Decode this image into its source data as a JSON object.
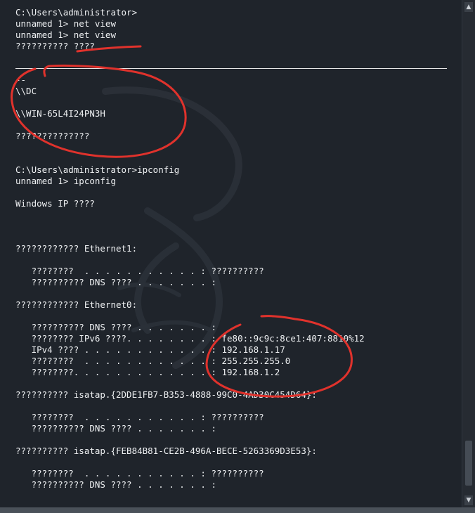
{
  "terminal": {
    "lines": [
      "C:\\Users\\administrator>",
      "unnamed 1> net view",
      "unnamed 1> net view",
      "?????????? ????",
      "",
      "",
      "--",
      "\\\\DC",
      "",
      "\\\\WIN-65L4I24PN3H",
      "",
      "??????????????",
      "",
      "",
      "C:\\Users\\administrator>ipconfig",
      "unnamed 1> ipconfig",
      "",
      "Windows IP ????",
      "",
      "",
      "",
      "???????????? Ethernet1:",
      "",
      "   ????????  . . . . . . . . . . . : ??????????",
      "   ?????????? DNS ???? . . . . . . . :",
      "",
      "???????????? Ethernet0:",
      "",
      "   ?????????? DNS ???? . . . . . . . :",
      "   ???????? IPv6 ????. . . . . . . . : fe80::9c9c:8ce1:407:8810%12",
      "   IPv4 ???? . . . . . . . . . . . . : 192.168.1.17",
      "   ????????  . . . . . . . . . . . . : 255.255.255.0",
      "   ????????. . . . . . . . . . . . . : 192.168.1.2",
      "",
      "?????????? isatap.{2DDE1FB7-B353-4888-99C0-4AD30C454D64}:",
      "",
      "   ????????  . . . . . . . . . . . : ??????????",
      "   ?????????? DNS ???? . . . . . . . :",
      "",
      "?????????? isatap.{FEB84B81-CE2B-496A-BECE-5263369D3E53}:",
      "",
      "   ????????  . . . . . . . . . . . : ??????????",
      "   ?????????? DNS ???? . . . . . . . :"
    ]
  },
  "colors": {
    "background": "#1f242b",
    "text": "#eef0f2",
    "annotation": "#e0322c"
  },
  "icons": {
    "scroll_up": "triangle-up-icon",
    "scroll_down": "triangle-down-icon"
  }
}
